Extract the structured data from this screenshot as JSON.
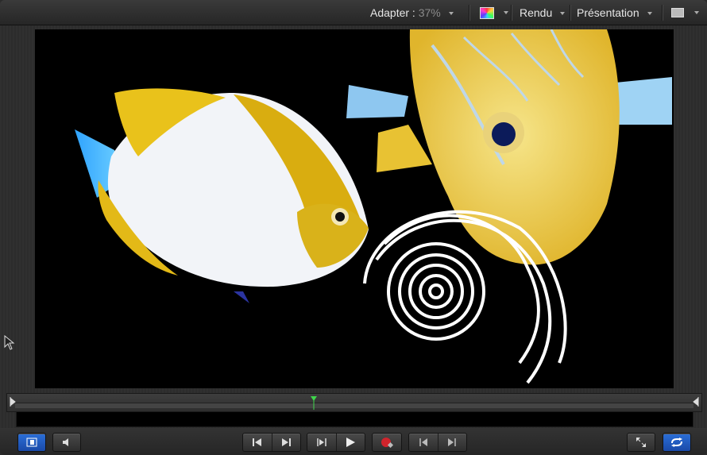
{
  "toolbar": {
    "fit_label": "Adapter :",
    "zoom": "37%",
    "render_label": "Rendu",
    "presentation_label": "Présentation"
  },
  "icons": {
    "color_channel": "color-wheel-icon",
    "view_layout": "view-layout-icon"
  },
  "colors": {
    "accent_blue": "#1f5fd0",
    "record_red": "#d0242c",
    "playhead_green": "#3fd64b"
  },
  "canvas": {
    "content": "composite of two tropical fish and a white spiral shape on black background"
  },
  "timeline": {
    "playhead_position": 0.44
  }
}
